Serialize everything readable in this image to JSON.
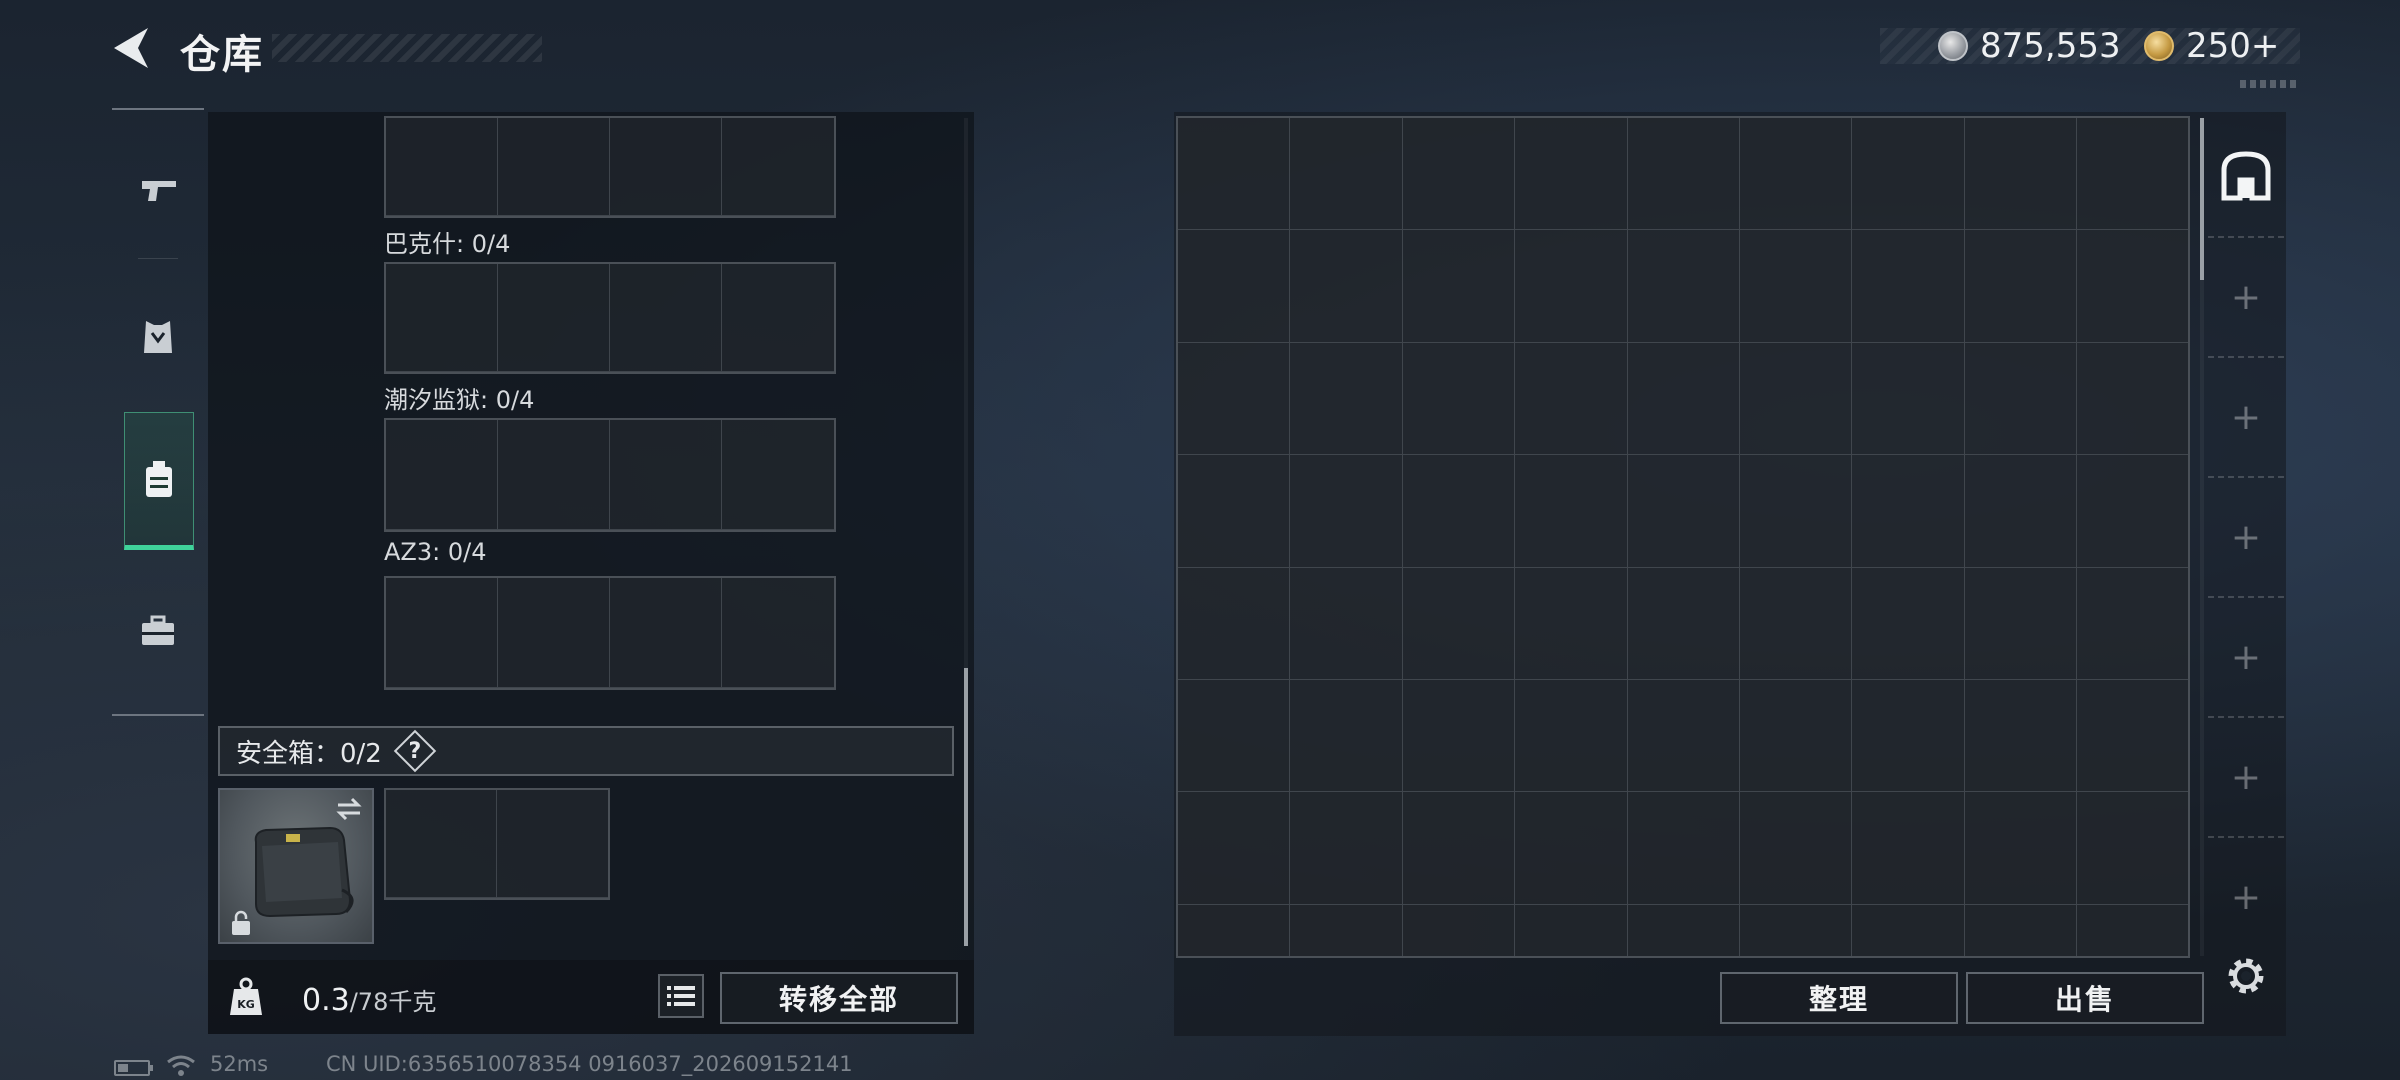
{
  "header": {
    "title": "仓库",
    "back_icon": "back-arrow-icon"
  },
  "currency": {
    "silver_amount": "875,553",
    "gold_amount": "250+"
  },
  "tabs": [
    {
      "name": "weapons",
      "icon": "pistol-icon"
    },
    {
      "name": "armor",
      "icon": "armor-vest-icon"
    },
    {
      "name": "backpack",
      "icon": "backpack-icon",
      "active": true
    },
    {
      "name": "toolbox",
      "icon": "toolbox-icon"
    }
  ],
  "left": {
    "slot_labels": [
      "巴克什: 0/4",
      "潮汐监狱: 0/4",
      "AZ3: 0/4"
    ],
    "safe_box_label": "安全箱：0/2",
    "help_mark": "?",
    "weight_current": "0.3",
    "weight_capacity": "/78千克",
    "transfer_all": "转移全部"
  },
  "right": {
    "organize": "整理",
    "sell": "出售",
    "side_add": "+"
  },
  "status": {
    "ping": "52ms",
    "uid": "CN UID:6356510078354 0916037_202609152141"
  }
}
